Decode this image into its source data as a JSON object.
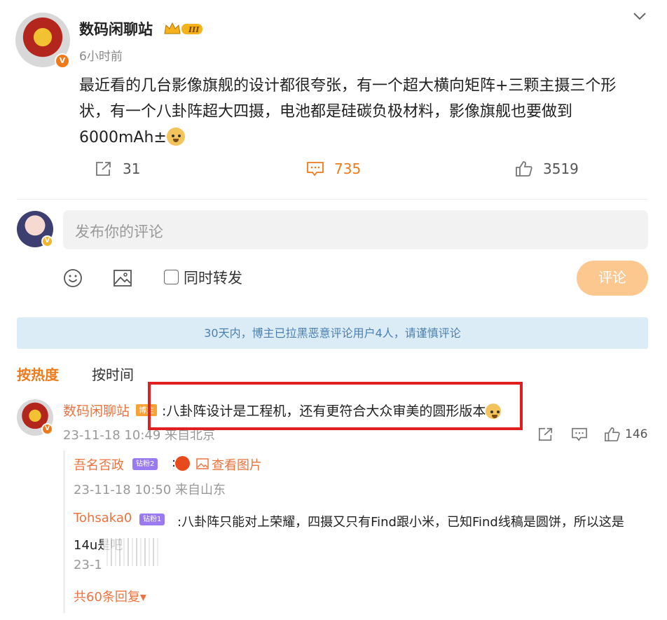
{
  "post": {
    "author": "数码闲聊站",
    "time": "6小时前",
    "text": "最近看的几台影像旗舰的设计都很夸张，有一个超大横向矩阵+三颗主摄三个形状，有一个八卦阵超大四摄，电池都是硅碳负极材料，影像旗舰也要做到6000mAh±",
    "badge_text": "V",
    "crown_level": "III",
    "shares": "31",
    "comments": "735",
    "likes": "3519"
  },
  "composer": {
    "placeholder": "发布你的评论",
    "repost_label": "同时转发",
    "submit_label": "评论"
  },
  "notice": "30天内，博主已拉黑恶意评论用户4人，请谨慎评论",
  "sort": {
    "hot": "按热度",
    "time": "按时间"
  },
  "comment": {
    "author": "数码闲聊站",
    "tag": "博主",
    "text": ":八卦阵设计是工程机，还有更符合大众审美的圆形版本",
    "meta": "23-11-18 10:49 来自北京",
    "likes": "146"
  },
  "replies": [
    {
      "author": "吾名否政",
      "badge": "钻粉2",
      "link": "查看图片",
      "meta": "23-11-18 10:50 来自山东"
    },
    {
      "author": "Tohsaka0",
      "badge": "钻粉1",
      "text": ":八卦阵只能对上荣耀，四摄又只有Find跟小米，已知Find线稿是圆饼，所以这是14u是吧",
      "meta": "23-1"
    }
  ],
  "more_replies": "共60条回复▾",
  "colors": {
    "accent": "#f07a1a",
    "author": "#eb7340",
    "notice_bg": "#dcecf7",
    "highlight": "#e02020"
  }
}
